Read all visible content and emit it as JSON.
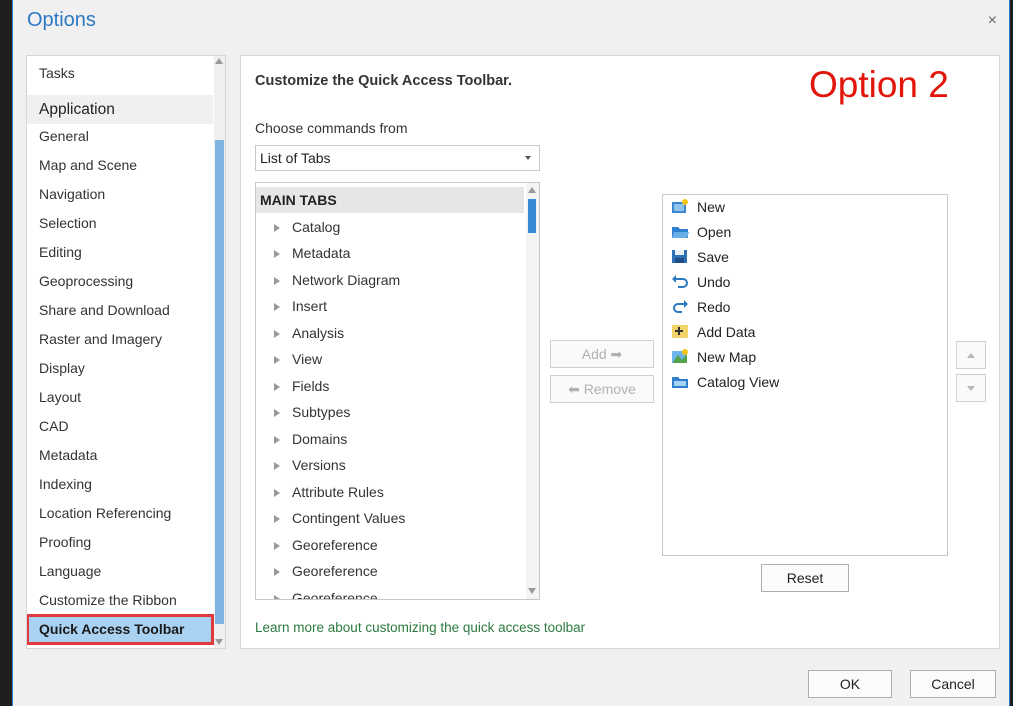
{
  "window": {
    "title": "Options",
    "close_glyph": "×"
  },
  "nav": {
    "items": [
      {
        "label": "Tasks",
        "kind": "item"
      },
      {
        "label": "Application",
        "kind": "group"
      },
      {
        "label": "General",
        "kind": "item"
      },
      {
        "label": "Map and Scene",
        "kind": "item"
      },
      {
        "label": "Navigation",
        "kind": "item"
      },
      {
        "label": "Selection",
        "kind": "item"
      },
      {
        "label": "Editing",
        "kind": "item"
      },
      {
        "label": "Geoprocessing",
        "kind": "item"
      },
      {
        "label": "Share and Download",
        "kind": "item"
      },
      {
        "label": "Raster and Imagery",
        "kind": "item"
      },
      {
        "label": "Display",
        "kind": "item"
      },
      {
        "label": "Layout",
        "kind": "item"
      },
      {
        "label": "CAD",
        "kind": "item"
      },
      {
        "label": "Metadata",
        "kind": "item"
      },
      {
        "label": "Indexing",
        "kind": "item"
      },
      {
        "label": "Location Referencing",
        "kind": "item"
      },
      {
        "label": "Proofing",
        "kind": "item"
      },
      {
        "label": "Language",
        "kind": "item"
      },
      {
        "label": "Customize the Ribbon",
        "kind": "item"
      },
      {
        "label": "Quick Access Toolbar",
        "kind": "selected"
      }
    ]
  },
  "main": {
    "heading": "Customize the Quick Access Toolbar.",
    "overlay_label": "Option 2",
    "choose_label": "Choose commands from",
    "choose_value": "List of Tabs",
    "command_list": {
      "header": "MAIN TABS",
      "items": [
        "Catalog",
        "Metadata",
        "Network Diagram",
        "Insert",
        "Analysis",
        "View",
        "Fields",
        "Subtypes",
        "Domains",
        "Versions",
        "Attribute Rules",
        "Contingent Values",
        "Georeference",
        "Georeference",
        "Georeference"
      ]
    },
    "add_label": "Add ➡",
    "remove_label": "⬅ Remove",
    "toolbar_items": [
      {
        "label": "New",
        "icon": "new-icon"
      },
      {
        "label": "Open",
        "icon": "open-folder-icon"
      },
      {
        "label": "Save",
        "icon": "save-icon"
      },
      {
        "label": "Undo",
        "icon": "undo-icon"
      },
      {
        "label": "Redo",
        "icon": "redo-icon"
      },
      {
        "label": "Add Data",
        "icon": "add-data-icon"
      },
      {
        "label": "New Map",
        "icon": "new-map-icon"
      },
      {
        "label": "Catalog View",
        "icon": "catalog-view-icon"
      }
    ],
    "reset_label": "Reset",
    "learn_more": "Learn more about customizing the quick access toolbar"
  },
  "footer": {
    "ok_label": "OK",
    "cancel_label": "Cancel"
  },
  "colors": {
    "accent": "#2c79c3",
    "selected_bg": "#a9d2f2",
    "highlight_border": "#e0393e",
    "overlay_red": "#e2150a",
    "link_green": "#2b7a3e"
  }
}
